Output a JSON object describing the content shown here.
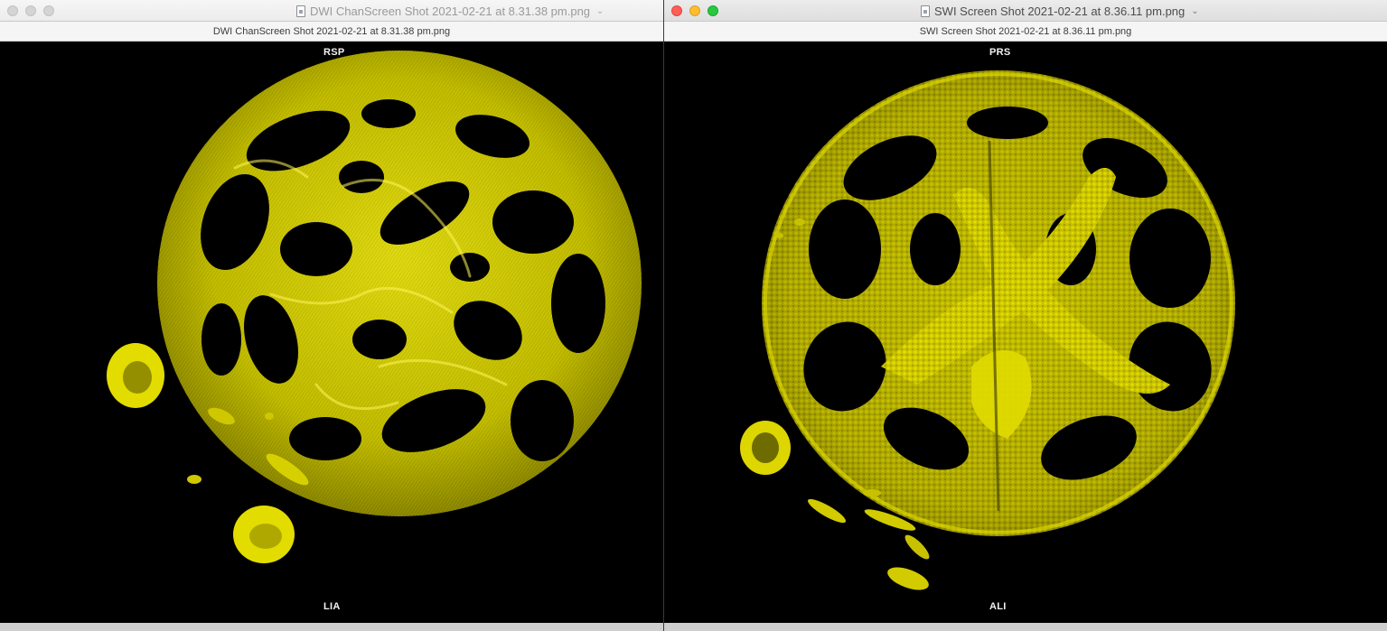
{
  "left_window": {
    "title": "DWI ChanScreen Shot 2021-02-21 at 8.31.38 pm.png",
    "subtitle": "DWI ChanScreen Shot 2021-02-21 at 8.31.38 pm.png",
    "orientation_top": "RSP",
    "orientation_bottom": "LIA",
    "active": false
  },
  "right_window": {
    "title": "SWI Screen Shot 2021-02-21 at 8.36.11 pm.png",
    "subtitle": "SWI Screen Shot 2021-02-21 at 8.36.11 pm.png",
    "orientation_top": "PRS",
    "orientation_bottom": "ALI",
    "active": true
  },
  "colors": {
    "render_yellow": "#e6e000",
    "render_shadow": "#6a6600",
    "background": "#000000"
  }
}
